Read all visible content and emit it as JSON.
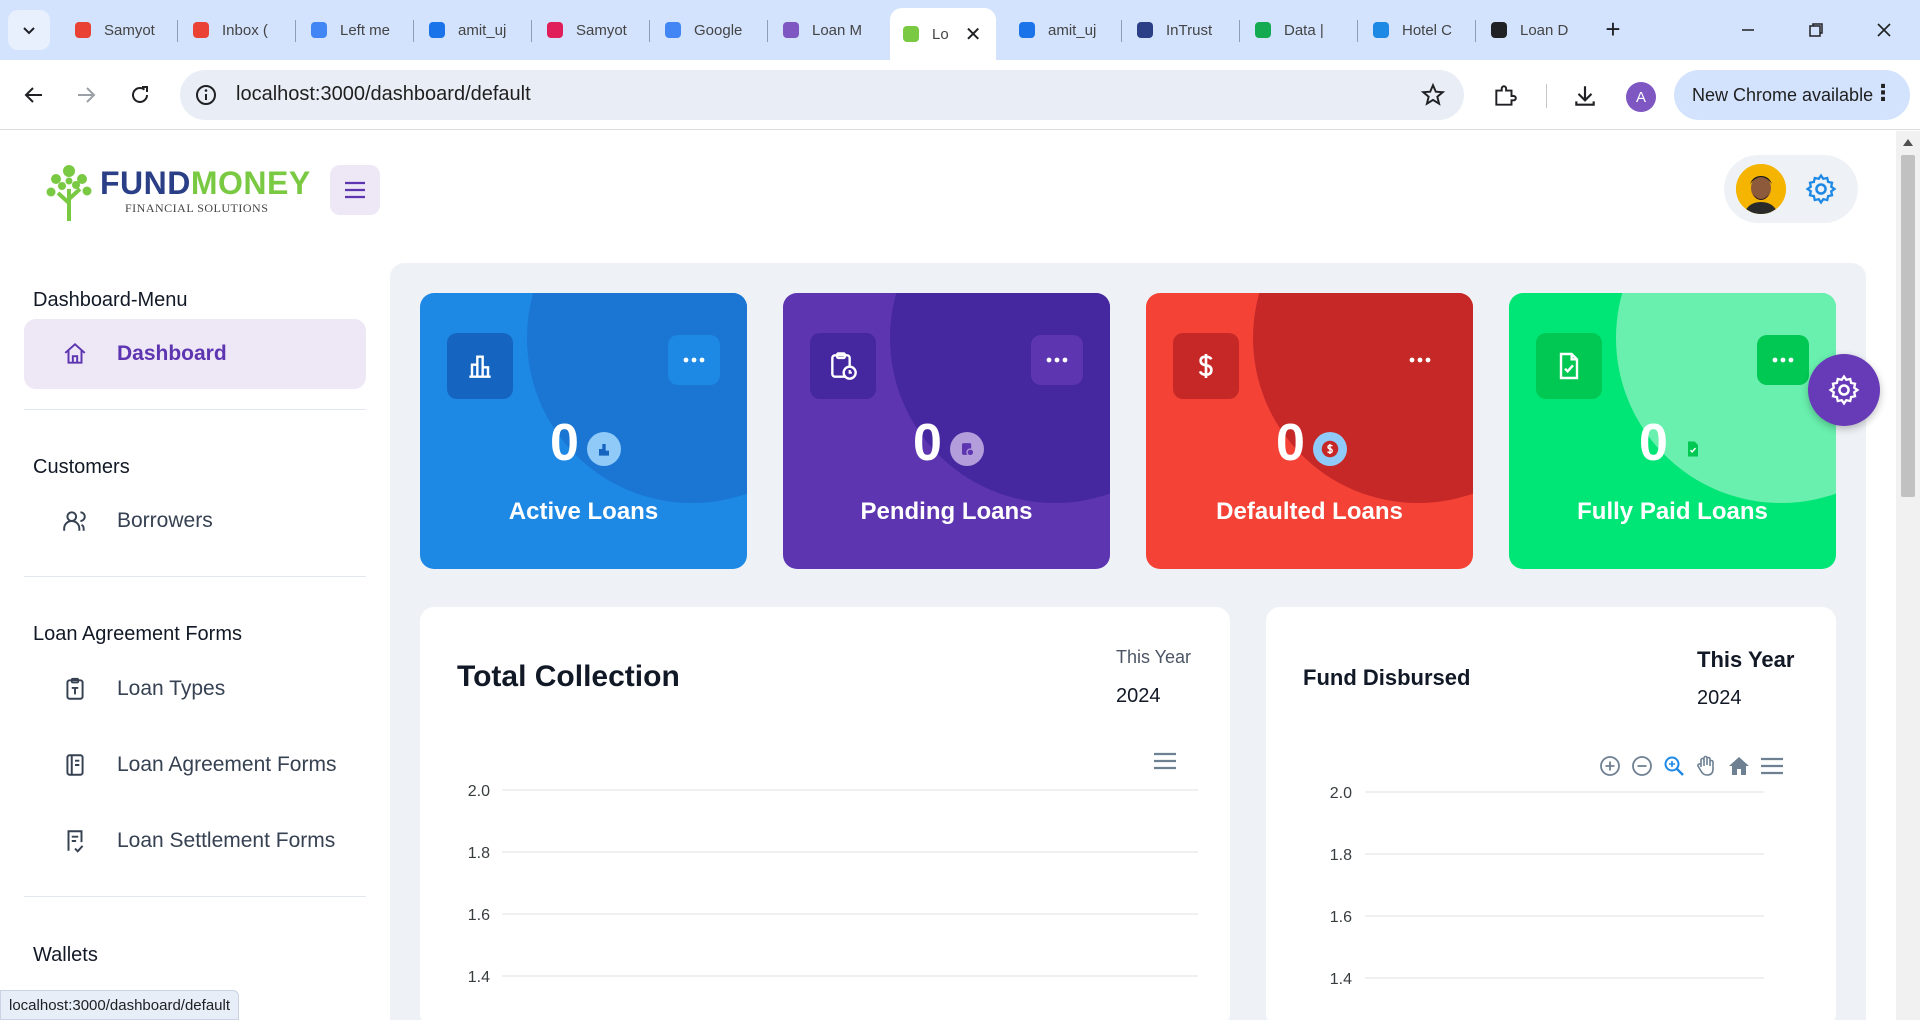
{
  "browser": {
    "tabs": [
      {
        "title": "Samyot",
        "icon": "samyot-icon",
        "color": "#e94235"
      },
      {
        "title": "Inbox (",
        "icon": "gmail-icon",
        "color": "#ea4335"
      },
      {
        "title": "Left me",
        "icon": "docs-icon",
        "color": "#4285f4"
      },
      {
        "title": "amit_uj",
        "icon": "bitbucket-icon",
        "color": "#1a73e8"
      },
      {
        "title": "Samyot",
        "icon": "slack-icon",
        "color": "#e01e5a"
      },
      {
        "title": "Google",
        "icon": "google-translate-icon",
        "color": "#4285f4"
      },
      {
        "title": "Loan M",
        "icon": "flask-icon",
        "color": "#7e57c2"
      },
      {
        "title": "Lo",
        "icon": "fundmoney-tree-icon",
        "color": "#7ac943"
      },
      {
        "title": "amit_uj",
        "icon": "bitbucket-icon",
        "color": "#1a73e8"
      },
      {
        "title": "InTrust",
        "icon": "intrust-icon",
        "color": "#2a3f86"
      },
      {
        "title": "Data | ",
        "icon": "mongodb-icon",
        "color": "#13aa52"
      },
      {
        "title": "Hotel C",
        "icon": "hotel-icon",
        "color": "#1e88e5"
      },
      {
        "title": "Loan D",
        "icon": "openai-icon",
        "color": "#202124"
      }
    ],
    "url": "localhost:3000/dashboard/default",
    "profile_initial": "A",
    "update_label": "New Chrome available",
    "status_url": "localhost:3000/dashboard/default"
  },
  "brand": {
    "name_part1": "FUND",
    "name_part2": "MONEY",
    "tagline": "FINANCIAL SOLUTIONS",
    "colors": {
      "navy": "#2a3f86",
      "green": "#7ac943"
    }
  },
  "sidebar": {
    "sections": [
      {
        "title": "Dashboard-Menu",
        "items": [
          {
            "label": "Dashboard",
            "icon": "home-icon",
            "active": true
          }
        ]
      },
      {
        "title": "Customers",
        "items": [
          {
            "label": "Borrowers",
            "icon": "users-icon"
          }
        ]
      },
      {
        "title": "Loan Agreement Forms",
        "items": [
          {
            "label": "Loan Types",
            "icon": "clipboard-icon"
          },
          {
            "label": "Loan Agreement Forms",
            "icon": "notebook-icon"
          },
          {
            "label": "Loan Settlement Forms",
            "icon": "file-check-icon"
          }
        ]
      },
      {
        "title": "Wallets",
        "items": []
      }
    ]
  },
  "stats": [
    {
      "label": "Active Loans",
      "value": "0",
      "icon": "bar-chart-icon",
      "color": "#1e88e5"
    },
    {
      "label": "Pending Loans",
      "value": "0",
      "icon": "clipboard-clock-icon",
      "color": "#5e35b1"
    },
    {
      "label": "Defaulted Loans",
      "value": "0",
      "icon": "dollar-icon",
      "color": "#f44336"
    },
    {
      "label": "Fully Paid Loans",
      "value": "0",
      "icon": "file-check-icon",
      "color": "#00e676"
    }
  ],
  "total_collection": {
    "title": "Total Collection",
    "period_label": "This Year",
    "year": "2024"
  },
  "fund_disbursed": {
    "title": "Fund Disbursed",
    "period_label": "This Year",
    "year": "2024"
  },
  "chart_data": [
    {
      "type": "line",
      "title": "Total Collection",
      "xlabel": "",
      "ylabel": "",
      "series": [],
      "y_ticks": [
        "2.0",
        "1.8",
        "1.6",
        "1.4"
      ],
      "grid": true
    },
    {
      "type": "line",
      "title": "Fund Disbursed",
      "xlabel": "",
      "ylabel": "",
      "series": [],
      "y_ticks": [
        "2.0",
        "1.8",
        "1.6",
        "1.4"
      ],
      "grid": true
    }
  ]
}
